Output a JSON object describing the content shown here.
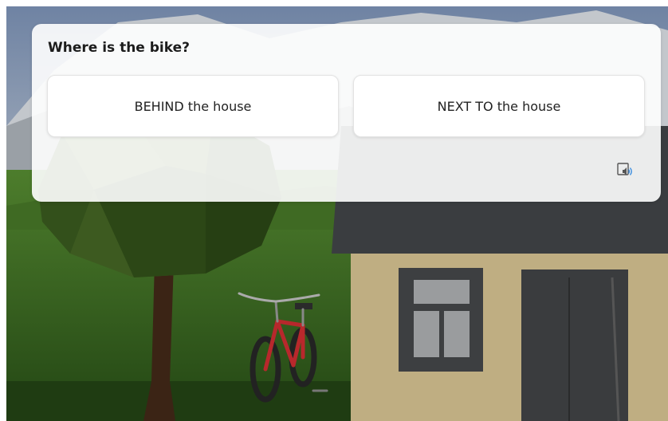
{
  "quiz": {
    "question": "Where is the bike?",
    "answers": [
      {
        "label": "BEHIND the house"
      },
      {
        "label": "NEXT TO the house"
      }
    ],
    "audio_icon": "speaker-icon"
  },
  "scene": {
    "sky_color": "#8898ad",
    "grass_color": "#2f5a1a",
    "house_wall_color": "#bfae82",
    "roof_color": "#3a3d40",
    "bike_color": "#b8282c",
    "tree_foliage_color": "#3d5a20"
  }
}
